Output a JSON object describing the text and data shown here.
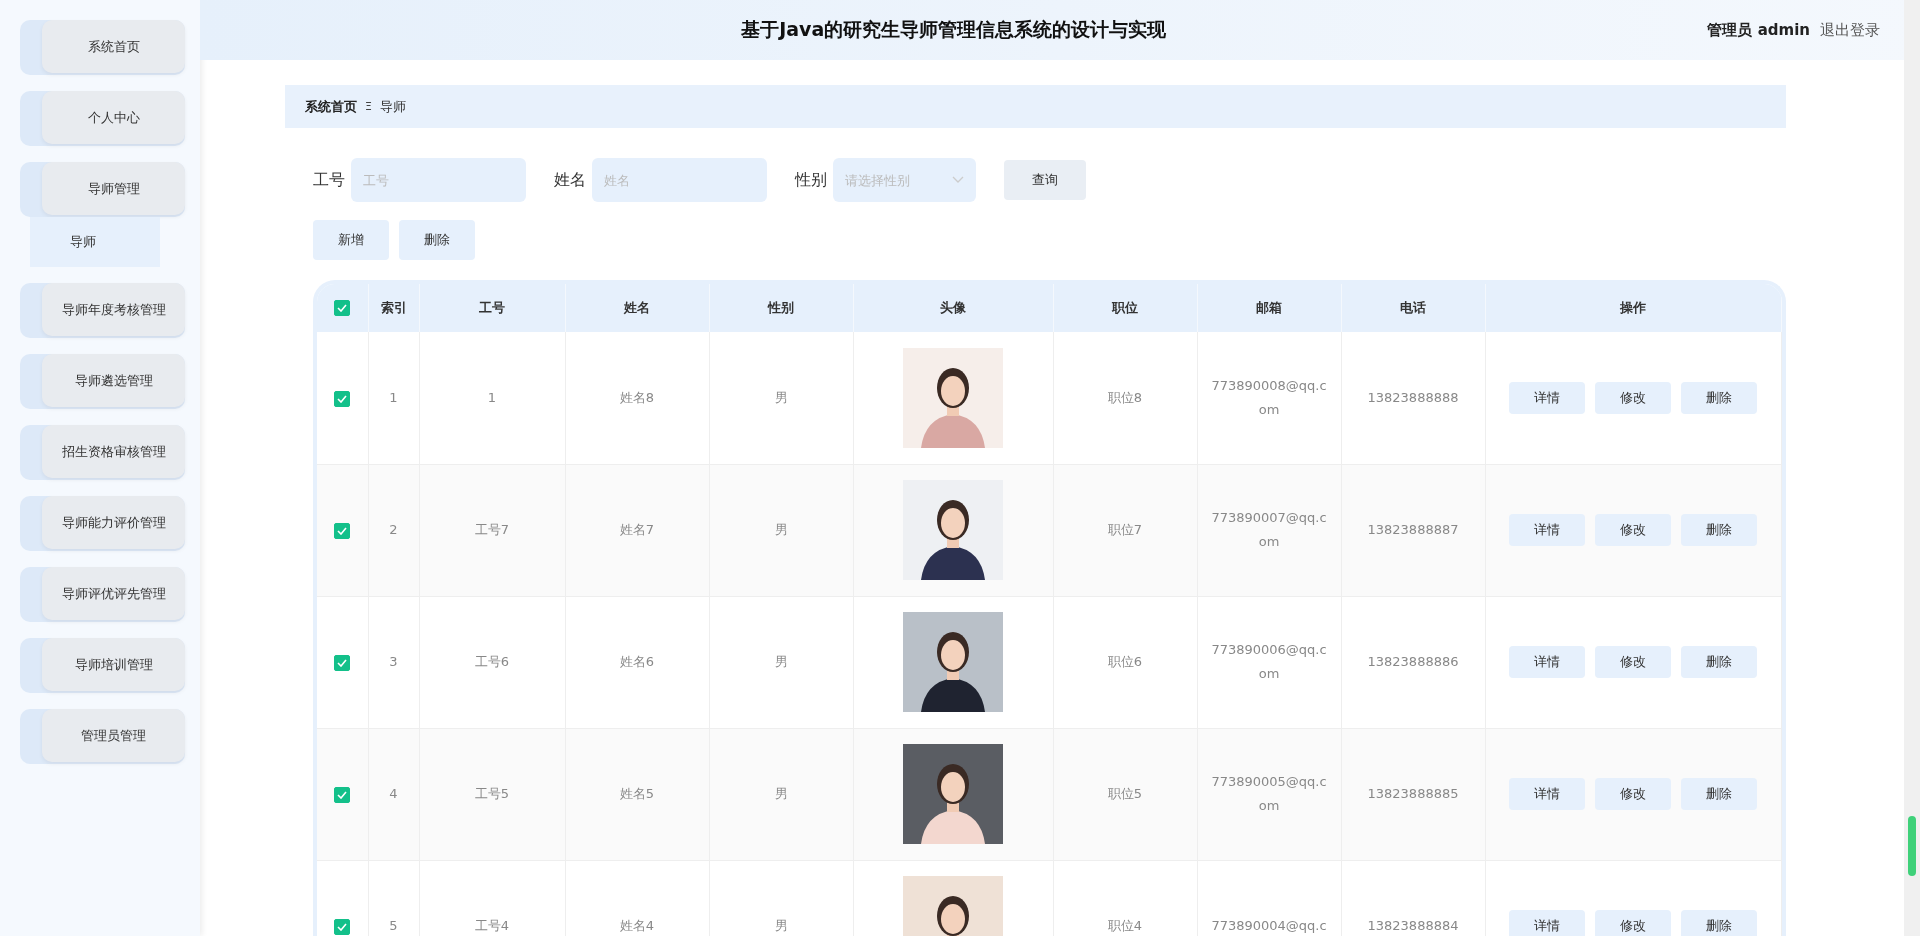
{
  "header": {
    "title": "基于Java的研究生导师管理信息系统的设计与实现",
    "user": "管理员 admin",
    "logout": "退出登录"
  },
  "sidebar": {
    "items": [
      {
        "label": "系统首页"
      },
      {
        "label": "个人中心"
      },
      {
        "label": "导师管理",
        "children": [
          {
            "label": "导师",
            "selected": true
          }
        ]
      },
      {
        "label": "导师年度考核管理"
      },
      {
        "label": "导师遴选管理"
      },
      {
        "label": "招生资格审核管理"
      },
      {
        "label": "导师能力评价管理"
      },
      {
        "label": "导师评优评先管理"
      },
      {
        "label": "导师培训管理"
      },
      {
        "label": "管理员管理"
      }
    ]
  },
  "breadcrumb": {
    "home": "系统首页",
    "separator": "Ξ",
    "current": "导师"
  },
  "search": {
    "fields": [
      {
        "kind": "input",
        "label": "工号",
        "placeholder": "工号"
      },
      {
        "kind": "input",
        "label": "姓名",
        "placeholder": "姓名"
      },
      {
        "kind": "select",
        "label": "性别",
        "placeholder": "请选择性别"
      }
    ],
    "button": "查询"
  },
  "actions": [
    "新增",
    "删除"
  ],
  "table": {
    "header_checked": true,
    "columns": [
      "索引",
      "工号",
      "姓名",
      "性别",
      "头像",
      "职位",
      "邮箱",
      "电话",
      "操作"
    ],
    "rows": [
      {
        "checked": true,
        "index": "1",
        "id": "1",
        "name": "姓名8",
        "gender": "男",
        "position": "职位8",
        "email": "773890008@qq.com",
        "phone": "13823888888",
        "actions": [
          "详情",
          "修改",
          "删除"
        ]
      },
      {
        "checked": true,
        "index": "2",
        "id": "工号7",
        "name": "姓名7",
        "gender": "男",
        "position": "职位7",
        "email": "773890007@qq.com",
        "phone": "13823888887",
        "actions": [
          "详情",
          "修改",
          "删除"
        ]
      },
      {
        "checked": true,
        "index": "3",
        "id": "工号6",
        "name": "姓名6",
        "gender": "男",
        "position": "职位6",
        "email": "773890006@qq.com",
        "phone": "13823888886",
        "actions": [
          "详情",
          "修改",
          "删除"
        ]
      },
      {
        "checked": true,
        "index": "4",
        "id": "工号5",
        "name": "姓名5",
        "gender": "男",
        "position": "职位5",
        "email": "773890005@qq.com",
        "phone": "13823888885",
        "actions": [
          "详情",
          "修改",
          "删除"
        ]
      },
      {
        "checked": true,
        "index": "5",
        "id": "工号4",
        "name": "姓名4",
        "gender": "男",
        "position": "职位4",
        "email": "773890004@qq.c",
        "phone": "13823888884",
        "actions": [
          "详情",
          "修改",
          "删除"
        ]
      }
    ]
  }
}
